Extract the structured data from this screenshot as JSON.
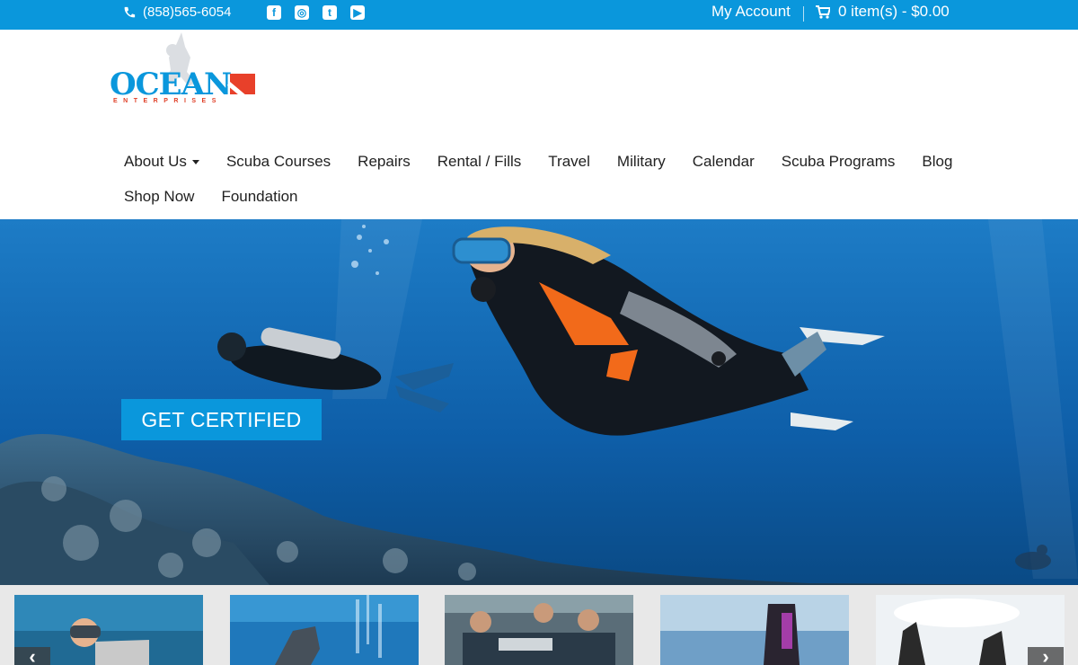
{
  "topbar": {
    "phone": "(858)565-6054",
    "socials": [
      {
        "icon": "facebook-icon",
        "glyph": "f"
      },
      {
        "icon": "instagram-icon",
        "glyph": "◎"
      },
      {
        "icon": "twitter-icon",
        "glyph": "t"
      },
      {
        "icon": "youtube-icon",
        "glyph": "▶"
      }
    ],
    "account": "My Account",
    "cart": "0 item(s) - $0.00"
  },
  "logo": {
    "word": "OCEAN",
    "sub": "ENTERPRISES"
  },
  "nav": {
    "row1": [
      "About Us",
      "Scuba Courses",
      "Repairs",
      "Rental / Fills",
      "Travel",
      "Military",
      "Calendar",
      "Scuba Programs",
      "Blog"
    ],
    "row2": [
      "Shop Now",
      "Foundation"
    ]
  },
  "hero": {
    "cta": "GET CERTIFIED"
  },
  "slider": {
    "prev": "‹",
    "next": "›"
  },
  "colors": {
    "brand_blue": "#0a97dc",
    "logo_red": "#e8402a"
  }
}
